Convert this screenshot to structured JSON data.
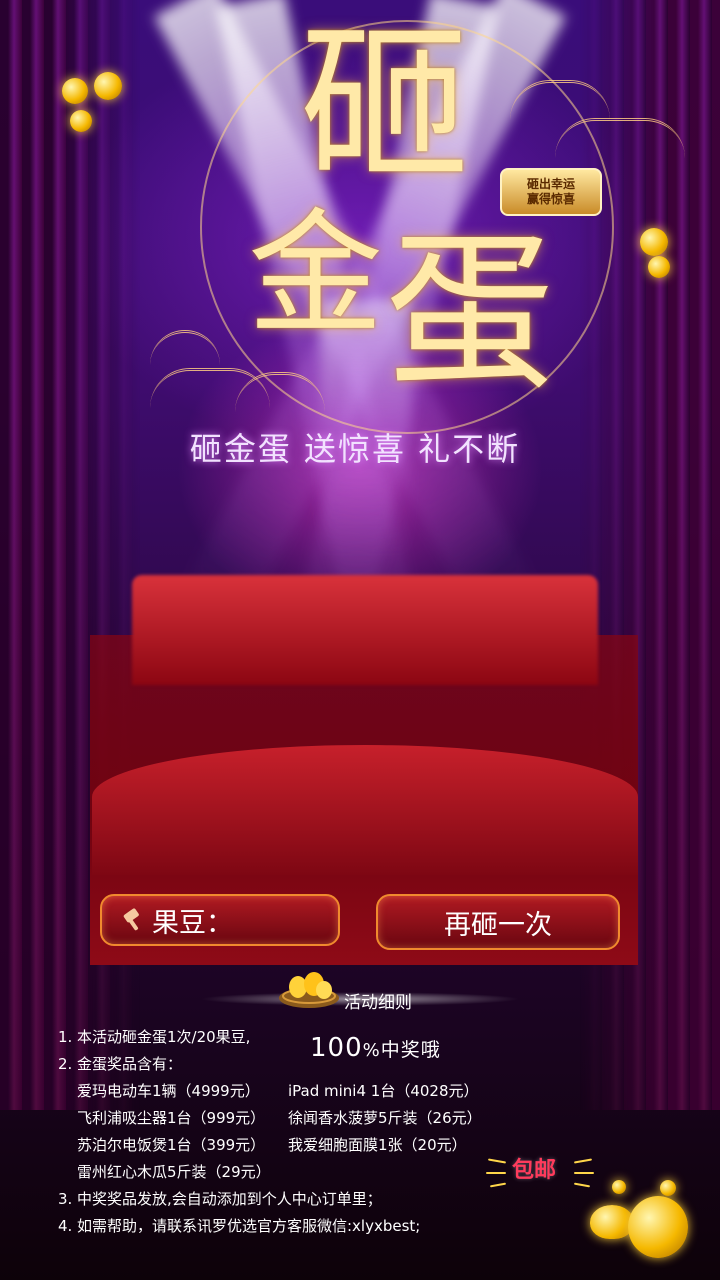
{
  "title": {
    "line1": "砸",
    "line2a": "金",
    "line2b": "蛋",
    "tag_line1": "砸出幸运",
    "tag_line2": "赢得惊喜",
    "subtitle": "砸金蛋 送惊喜 礼不断"
  },
  "buttons": {
    "dou_label": "果豆：",
    "again_label": "再砸一次"
  },
  "rules": {
    "heading": "活动细则",
    "badge_text": "100",
    "badge_percent": "%",
    "badge_suffix": "中奖哦",
    "items": [
      {
        "num": "1.",
        "text": "本活动砸金蛋1次/20果豆,"
      },
      {
        "num": "2.",
        "text": "金蛋奖品含有："
      }
    ],
    "prizes": [
      [
        "爱玛电动车1辆（4999元）",
        "iPad mini4 1台（4028元）"
      ],
      [
        "飞利浦吸尘器1台（999元）",
        "徐闻香水菠萝5斤装（26元）"
      ],
      [
        "苏泊尔电饭煲1台（399元）",
        "我爱细胞面膜1张（20元）"
      ],
      [
        "雷州红心木瓜5斤装（29元）",
        ""
      ]
    ],
    "tail": [
      {
        "num": "3.",
        "text": "中奖奖品发放,会自动添加到个人中心订单里；"
      },
      {
        "num": "4.",
        "text": "如需帮助，请联系讯罗优选官方客服微信:xlyxbest;"
      }
    ]
  },
  "promo": {
    "free_shipping": "包邮"
  },
  "colors": {
    "gold": "#ffe9a8",
    "button_border": "#f08a2e",
    "button_fill": "#8c0612",
    "promo_red": "#ff3b5c"
  },
  "icons": {
    "hammer": "hammer-icon",
    "nest": "golden-egg-nest-icon",
    "coin": "gold-coin-icon"
  }
}
